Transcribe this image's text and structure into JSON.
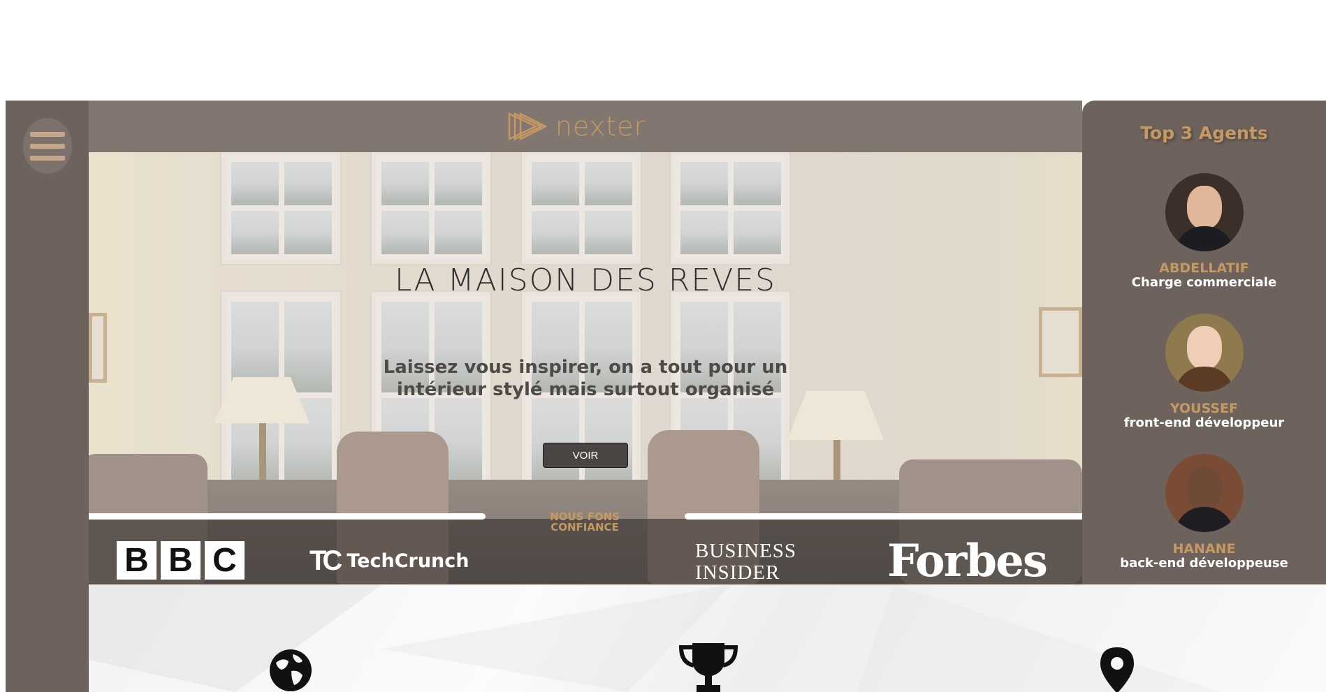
{
  "brand": {
    "name": "nexter",
    "accent": "#c69963"
  },
  "sidebar": {
    "menu_icon": "hamburger-menu-icon"
  },
  "hero": {
    "title": "LA MAISON DES REVES",
    "subtitle_line1": "Laissez vous inspirer, on a tout pour un",
    "subtitle_line2": "intérieur stylé mais surtout organisé",
    "button_label": "VOIR"
  },
  "trust": {
    "label_line1": "NOUS FONS",
    "label_line2": "CONFIANCE",
    "logos": {
      "bbc": [
        "B",
        "B",
        "C"
      ],
      "techcrunch_mark": "TC",
      "techcrunch_word": "TechCrunch",
      "business_insider_line1": "BUSINESS",
      "business_insider_line2": "INSIDER",
      "forbes": "Forbes"
    }
  },
  "agents": {
    "title": "Top 3 Agents",
    "items": [
      {
        "name": "ABDELLATIF",
        "role": "Charge commerciale"
      },
      {
        "name": "YOUSSEF",
        "role": "front-end développeur"
      },
      {
        "name": "HANANE",
        "role": "back-end développeuse"
      }
    ]
  },
  "features": {
    "icons": [
      "globe-icon",
      "trophy-icon",
      "map-pin-icon"
    ]
  },
  "colors": {
    "sidebar": "#6d625c",
    "header": "#827670",
    "button": "#4a4542"
  }
}
